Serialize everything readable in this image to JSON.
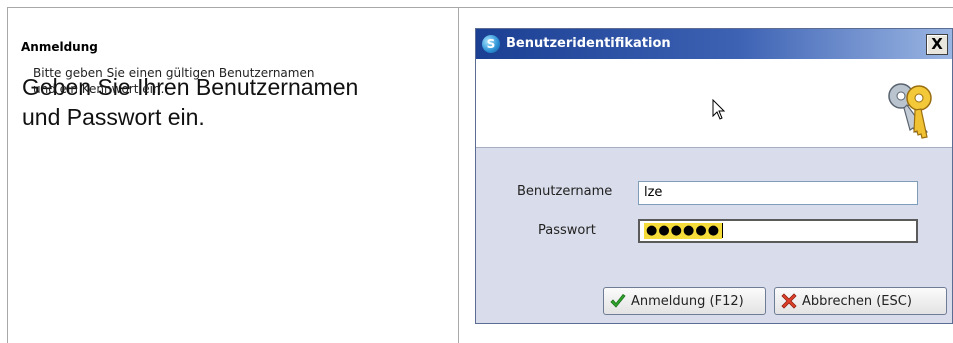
{
  "instruction": {
    "line1": "Geben Sie Ihren Benutzernamen",
    "line2": "und Passwort ein."
  },
  "dialog": {
    "title": "Benutzeridentifikation",
    "app_icon": "s-logo-icon",
    "close_label": "X",
    "header": {
      "title": "Anmeldung",
      "description_line1": "Bitte geben Sie einen gültigen Benutzernamen",
      "description_line2": "und ein Kennwort ein.",
      "icon": "keys-icon"
    },
    "fields": {
      "username_label": "Benutzername",
      "username_value": "lze",
      "password_label": "Passwort",
      "password_value": "●●●●●●"
    },
    "buttons": {
      "login_label": "Anmeldung (F12)",
      "cancel_label": "Abbrechen (ESC)"
    }
  },
  "colors": {
    "titlebar_start": "#1b3f92",
    "titlebar_end": "#9bb6e3",
    "dialog_bg": "#d9dcea",
    "password_highlight": "#f5dc3a"
  }
}
